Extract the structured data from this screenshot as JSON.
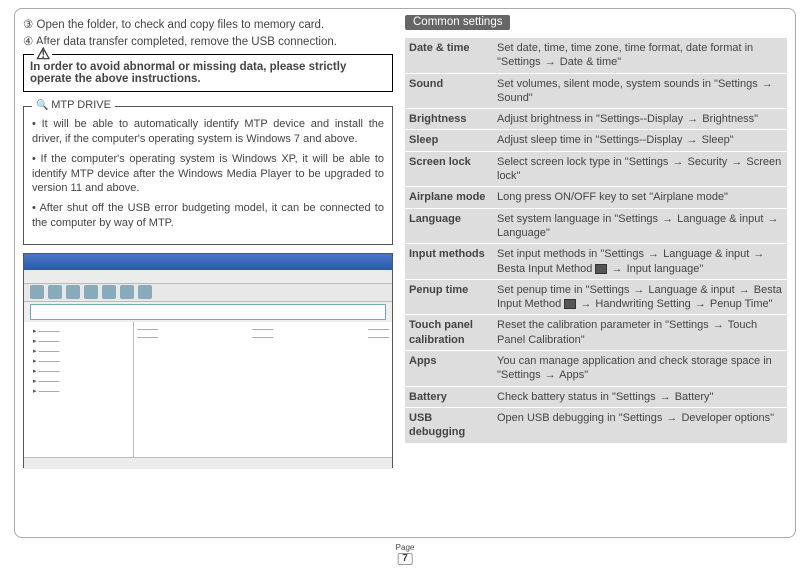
{
  "left": {
    "step3": "③ Open the folder, to check and copy files to memory card.",
    "step4": "④ After data transfer completed, remove the USB connection.",
    "warning": "In order to avoid abnormal or missing data, please strictly operate the above instructions.",
    "mtp_title": "MTP DRIVE",
    "mtp1": "• It will be able to automatically identify MTP device and install the driver, if the computer's operating system is Windows 7 and above.",
    "mtp2": "• If the computer's operating system is Windows XP, it will be able to identify MTP device after the Windows Media Player to be upgraded to version 11 and above.",
    "mtp3": "• After shut off the USB error budgeting model, it can be connected to the computer by way of MTP."
  },
  "right": {
    "header": "Common settings",
    "rows": [
      {
        "k": "Date & time",
        "v": "Set date, time, time zone, time format, date format in \"Settings → Date & time\""
      },
      {
        "k": "Sound",
        "v": "Set volumes, silent mode, system sounds in \"Settings → Sound\""
      },
      {
        "k": "Brightness",
        "v": "Adjust brightness in \"Settings--Display → Brightness\""
      },
      {
        "k": "Sleep",
        "v": "Adjust sleep time in \"Settings--Display → Sleep\""
      },
      {
        "k": "Screen lock",
        "v": "Select screen lock type in \"Settings → Security →  Screen lock\""
      },
      {
        "k": "Airplane mode",
        "v": "Long press ON/OFF key to set \"Airplane mode\""
      },
      {
        "k": "Language",
        "v": "Set system language in  \"Settings → Language & input → Language\""
      },
      {
        "k": "Input methods",
        "v": "Set input methods in \"Settings → Language & input → Besta Input Method ⌨ → Input language\""
      },
      {
        "k": "Penup time",
        "v": "Set penup time in \"Settings → Language & input → Besta Input Method ⌨ → Handwriting Setting → Penup Time\""
      },
      {
        "k": "Touch panel calibration",
        "v": "Reset the calibration parameter in \"Settings → Touch Panel Calibration\""
      },
      {
        "k": "Apps",
        "v": "You can manage application and check storage space in  \"Settings → Apps\""
      },
      {
        "k": "Battery",
        "v": "Check battery status in  \"Settings → Battery\""
      },
      {
        "k": "USB debugging",
        "v": "Open USB debugging in \"Settings → Developer options\""
      }
    ]
  },
  "page": {
    "label": "Page",
    "num": "7"
  }
}
